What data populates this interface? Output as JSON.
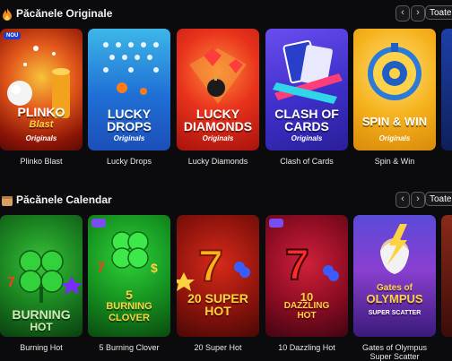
{
  "sections": [
    {
      "title": "Păcănele Originale",
      "icon": "flame-icon",
      "prev_label": "‹",
      "next_label": "›",
      "all_label": "Toate",
      "games": [
        {
          "name": "Plinko Blast",
          "art_title_1": "PLINKO",
          "art_title_2": "Blast",
          "tag": "Originals",
          "badge": "NOU"
        },
        {
          "name": "Lucky Drops",
          "art_title_1": "LUCKY",
          "art_title_2": "DROPS",
          "tag": "Originals"
        },
        {
          "name": "Lucky Diamonds",
          "art_title_1": "LUCKY",
          "art_title_2": "DIAMONDS",
          "tag": "Originals"
        },
        {
          "name": "Clash of Cards",
          "art_title_1": "CLASH OF",
          "art_title_2": "CARDS",
          "tag": "Originals"
        },
        {
          "name": "Spin & Win",
          "art_title_1": "SPIN & WIN",
          "art_title_2": "",
          "tag": "Originals"
        }
      ]
    },
    {
      "title": "Păcănele Calendar",
      "icon": "calendar-icon",
      "prev_label": "‹",
      "next_label": "›",
      "all_label": "Toate",
      "games": [
        {
          "name": "Burning Hot",
          "art_title_1": "BURNING",
          "art_title_2": "HOT"
        },
        {
          "name": "5 Burning Clover",
          "art_title_1": "5",
          "art_title_2": "BURNING CLOVER"
        },
        {
          "name": "20 Super Hot",
          "art_title_1": "20 SUPER",
          "art_title_2": "HOT"
        },
        {
          "name": "10 Dazzling Hot",
          "art_title_1": "10",
          "art_title_2": "DAZZLING HOT"
        },
        {
          "name": "Gates of Olympus",
          "name_line2": "Super Scatter",
          "art_title_1": "Gates of",
          "art_title_2": "OLYMPUS",
          "art_title_3": "SUPER SCATTER"
        }
      ]
    }
  ],
  "colors": {
    "background": "#0b0b0d",
    "button_border": "#5a5a60",
    "flame": "#f28a1b",
    "calendar": "#d9a066"
  }
}
